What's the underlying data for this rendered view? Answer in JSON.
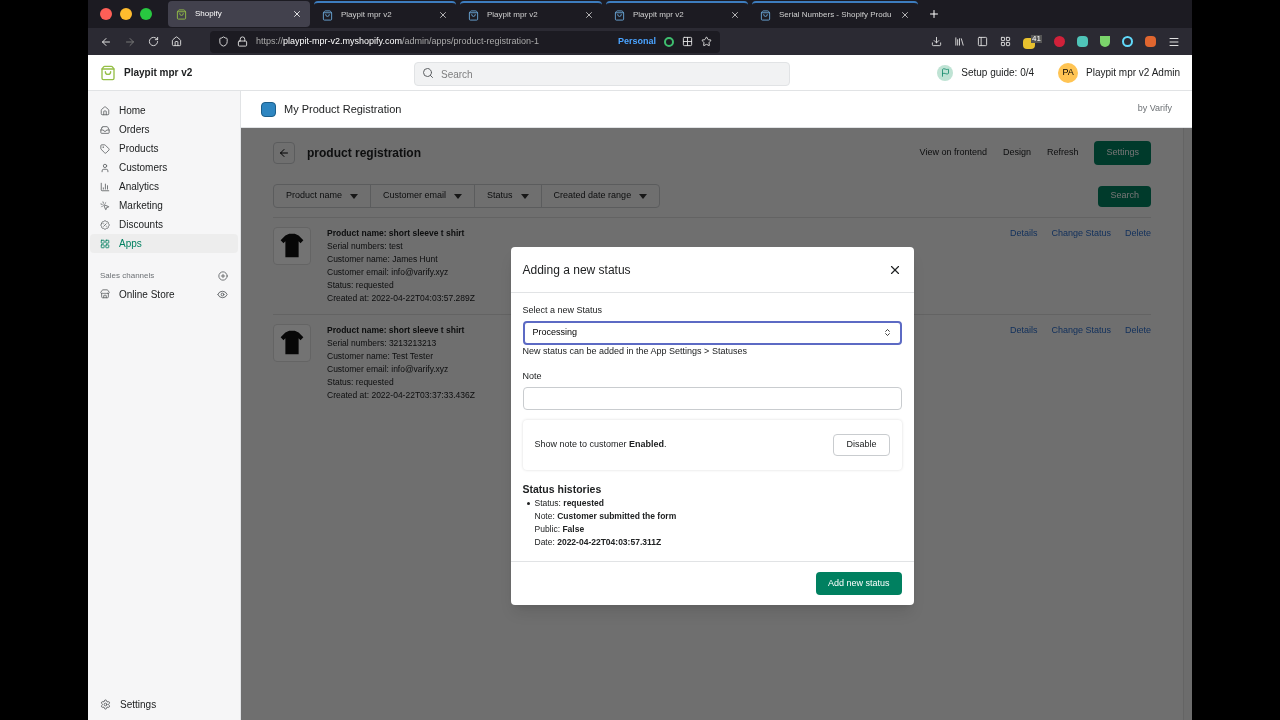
{
  "browser": {
    "tabs": [
      {
        "title": "Shopify",
        "selected": true
      },
      {
        "title": "Playpit mpr v2",
        "selected": false
      },
      {
        "title": "Playpit mpr v2",
        "selected": false
      },
      {
        "title": "Playpit mpr v2",
        "selected": false
      },
      {
        "title": "Serial Numbers - Shopify Produ",
        "selected": false
      }
    ],
    "url_host": "playpit-mpr-v2.myshopify.com",
    "url_scheme": "https://",
    "url_path": "/admin/apps/product-registration-1",
    "container": "Personal",
    "extension_badge": "41"
  },
  "topbar": {
    "store": "Playpit mpr v2",
    "search_placeholder": "Search",
    "setup_guide": "Setup guide: 0/4",
    "avatar": "PA",
    "account": "Playpit mpr v2 Admin"
  },
  "sidebar": {
    "items": [
      {
        "label": "Home",
        "selected": false
      },
      {
        "label": "Orders",
        "selected": false
      },
      {
        "label": "Products",
        "selected": false
      },
      {
        "label": "Customers",
        "selected": false
      },
      {
        "label": "Analytics",
        "selected": false
      },
      {
        "label": "Marketing",
        "selected": false
      },
      {
        "label": "Discounts",
        "selected": false
      },
      {
        "label": "Apps",
        "selected": true
      }
    ],
    "channels_heading": "Sales channels",
    "channels": [
      {
        "label": "Online Store"
      }
    ],
    "settings": "Settings"
  },
  "app": {
    "title": "My Product Registration",
    "vendor": "by Varify",
    "page_title": "product registration",
    "actions": [
      {
        "label": "View on frontend",
        "kind": "plain"
      },
      {
        "label": "Design",
        "kind": "plain"
      },
      {
        "label": "Refresh",
        "kind": "plain"
      },
      {
        "label": "Settings",
        "kind": "primary"
      }
    ],
    "filters": [
      "Product name",
      "Customer email",
      "Status",
      "Created date range"
    ],
    "search_button": "Search",
    "registrations": [
      {
        "product": "Product name: short sleeve t shirt",
        "lines": [
          "Serial numbers: test",
          "Customer name: James Hunt",
          "Customer email: info@varify.xyz",
          "Status: requested",
          "Created at: 2022-04-22T04:03:57.289Z"
        ],
        "actions": [
          "Details",
          "Change Status",
          "Delete"
        ]
      },
      {
        "product": "Product name: short sleeve t shirt",
        "lines": [
          "Serial numbers: 3213213213",
          "Customer name: Test Tester",
          "Customer email: info@varify.xyz",
          "Status: requested",
          "Created at: 2022-04-22T03:37:33.436Z"
        ],
        "actions": [
          "Details",
          "Change Status",
          "Delete"
        ]
      }
    ]
  },
  "modal": {
    "title": "Adding a new status",
    "select_label": "Select a new Status",
    "select_value": "Processing",
    "help": "New status can be added in the App Settings > Statuses",
    "note_label": "Note",
    "visibility_text": "Show note to customer **Enabled**.",
    "visibility_button": "Disable",
    "history_heading": "Status histories",
    "histories": [
      {
        "lines": [
          "Status: **requested**",
          "Note: **Customer submitted the form**",
          "Public: **False**",
          "Date: **2022-04-22T04:03:57.311Z**"
        ]
      }
    ],
    "submit": "Add new status"
  }
}
